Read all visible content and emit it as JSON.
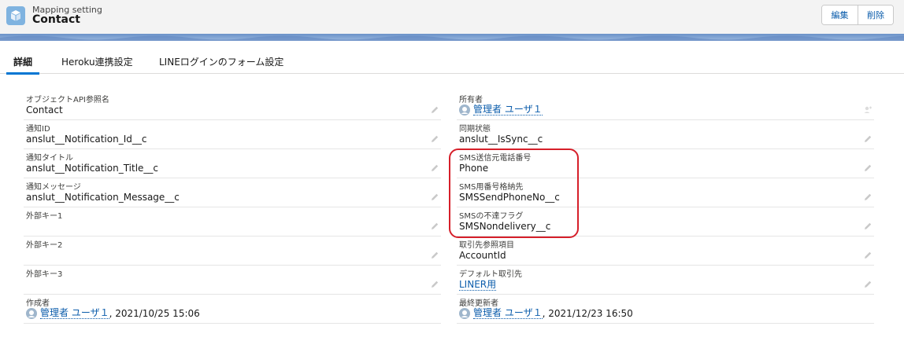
{
  "header": {
    "object_type": "Mapping setting",
    "record_name": "Contact",
    "edit_label": "編集",
    "delete_label": "削除"
  },
  "tabs": [
    {
      "label": "詳細"
    },
    {
      "label": "Heroku連携設定"
    },
    {
      "label": "LINEログインのフォーム設定"
    }
  ],
  "left_fields": [
    {
      "label": "オブジェクトAPI参照名",
      "value": "Contact"
    },
    {
      "label": "通知ID",
      "value": "anslut__Notification_Id__c"
    },
    {
      "label": "通知タイトル",
      "value": "anslut__Notification_Title__c"
    },
    {
      "label": "通知メッセージ",
      "value": "anslut__Notification_Message__c"
    },
    {
      "label": "外部キー1",
      "value": ""
    },
    {
      "label": "外部キー2",
      "value": ""
    },
    {
      "label": "外部キー3",
      "value": ""
    }
  ],
  "right_fields": [
    {
      "label": "所有者",
      "value": "管理者 ユーザ１"
    },
    {
      "label": "同期状態",
      "value": "anslut__IsSync__c"
    },
    {
      "label": "SMS送信元電話番号",
      "value": "Phone"
    },
    {
      "label": "SMS用番号格納先",
      "value": "SMSSendPhoneNo__c"
    },
    {
      "label": "SMSの不達フラグ",
      "value": "SMSNondelivery__c"
    },
    {
      "label": "取引先参照項目",
      "value": "AccountId"
    },
    {
      "label": "デフォルト取引先",
      "value": "LINER用"
    }
  ],
  "created": {
    "label": "作成者",
    "user": "管理者 ユーザ１",
    "date": ", 2021/10/25 15:06"
  },
  "modified": {
    "label": "最終更新者",
    "user": "管理者 ユーザ１",
    "date": ", 2021/12/23 16:50"
  },
  "colors": {
    "highlight": "#d61f2a",
    "link": "#0b5cab",
    "tab_active": "#0176d3"
  },
  "icons": [
    "cube-icon",
    "pencil-icon",
    "user-avatar-icon",
    "change-owner-icon"
  ]
}
